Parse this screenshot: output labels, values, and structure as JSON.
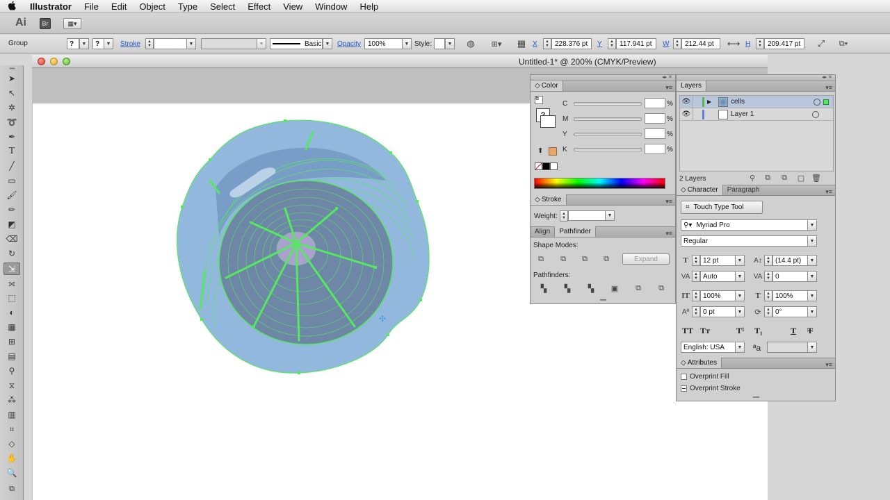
{
  "menubar": {
    "apple": "",
    "app": "Illustrator",
    "items": [
      "File",
      "Edit",
      "Object",
      "Type",
      "Select",
      "Effect",
      "View",
      "Window",
      "Help"
    ]
  },
  "appbar": {
    "ai_label": "Ai",
    "bridge_label": "Br"
  },
  "controlbar": {
    "selection_type": "Group",
    "fill_value": "?",
    "stroke_value": "?",
    "stroke_label": "Stroke",
    "stroke_weight": "",
    "brush_label": "Basic",
    "opacity_label": "Opacity",
    "opacity_value": "100%",
    "style_label": "Style",
    "x_label": "X",
    "x_value": "228.376 pt",
    "y_label": "Y",
    "y_value": "117.941 pt",
    "w_label": "W",
    "w_value": "212.44 pt",
    "h_label": "H",
    "h_value": "209.417 pt"
  },
  "document": {
    "title": "Untitled-1* @ 200% (CMYK/Preview)"
  },
  "colorpanel": {
    "tab": "Color",
    "unknown": "?",
    "channels": [
      {
        "label": "C",
        "value": ""
      },
      {
        "label": "M",
        "value": ""
      },
      {
        "label": "Y",
        "value": ""
      },
      {
        "label": "K",
        "value": ""
      }
    ],
    "pct": "%",
    "swatch_color": "#e9a466"
  },
  "strokepanel": {
    "tab": "Stroke",
    "weight_label": "Weight:",
    "weight_value": ""
  },
  "pathfinder": {
    "tab_align": "Align",
    "tab_pathfinder": "Pathfinder",
    "shape_modes": "Shape Modes:",
    "expand": "Expand",
    "pathfinders": "Pathfinders:"
  },
  "layers": {
    "tab": "Layers",
    "rows": [
      {
        "name": "cells",
        "color": "#4db84d"
      },
      {
        "name": "Layer 1",
        "color": "#5b7fe0"
      }
    ],
    "count": "2 Layers"
  },
  "character": {
    "tab": "Character",
    "tab2": "Paragraph",
    "touch_type": "Touch Type Tool",
    "font": "Myriad Pro",
    "style": "Regular",
    "size": "12 pt",
    "leading": "(14.4 pt)",
    "kerning": "Auto",
    "tracking": "0",
    "vscale": "100%",
    "hscale": "100%",
    "baseline": "0 pt",
    "rotation": "0°",
    "language": "English: USA",
    "aa": ""
  },
  "attributes": {
    "tab": "Attributes",
    "overprint_fill": "Overprint Fill",
    "overprint_stroke": "Overprint Stroke"
  },
  "colors": {
    "accent_green": "#56e860",
    "cell_blue": "#91b5dc",
    "cell_dark": "#6a8cb3"
  }
}
